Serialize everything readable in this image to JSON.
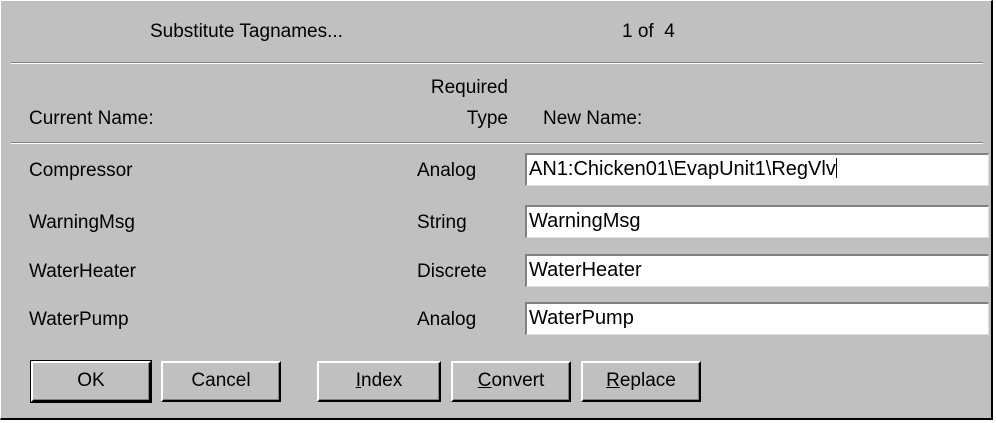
{
  "header": {
    "title": "Substitute Tagnames...",
    "page_indicator": "1 of  4"
  },
  "columns": {
    "current_name": "Current Name:",
    "required_type_line1": "Required",
    "required_type_line2": "Type",
    "new_name": "New Name:"
  },
  "rows": [
    {
      "current": "Compressor",
      "type": "Analog",
      "new_name": "AN1:Chicken01\\EvapUnit1\\RegVlv"
    },
    {
      "current": "WarningMsg",
      "type": "String",
      "new_name": "WarningMsg"
    },
    {
      "current": "WaterHeater",
      "type": "Discrete",
      "new_name": "WaterHeater"
    },
    {
      "current": "WaterPump",
      "type": "Analog",
      "new_name": "WaterPump"
    }
  ],
  "buttons": {
    "ok": "OK",
    "cancel": "Cancel",
    "index_key": "I",
    "index_rest": "ndex",
    "convert_key": "C",
    "convert_rest": "onvert",
    "replace_key": "R",
    "replace_rest": "eplace"
  }
}
